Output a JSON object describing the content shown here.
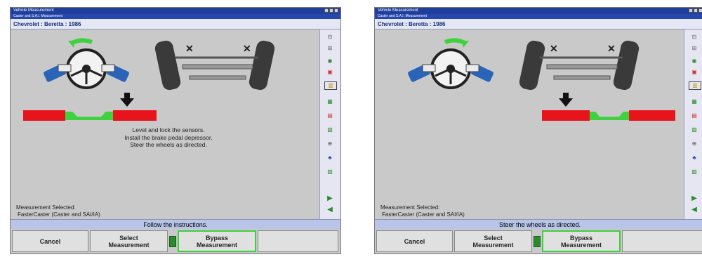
{
  "windows": [
    {
      "titlebar": "Vehicle Measurement",
      "subbar": "Caster and S.A.I. Measurement",
      "vehicle": "Chevrolet : Beretta : 1986",
      "instructions": [
        "Level and lock the sensors.",
        "Install the brake pedal depressor.",
        "Steer the wheels as directed."
      ],
      "measurement": {
        "heading": "Measurement Selected:",
        "value": "FasterCaster (Caster and SAI/IA)"
      },
      "status": "Follow the instructions.",
      "buttons": {
        "cancel": "Cancel",
        "select": "Select\nMeasurement",
        "bypass": "Bypass\nMeasurement"
      },
      "indicator_position": "right"
    },
    {
      "titlebar": "Vehicle Measurement",
      "subbar": "Caster and S.A.I. Measurement",
      "vehicle": "Chevrolet : Beretta : 1986",
      "instructions": [],
      "measurement": {
        "heading": "Measurement Selected:",
        "value": "FasterCaster (Caster and SAI/IA)"
      },
      "status": "Steer the wheels as directed.",
      "buttons": {
        "cancel": "Cancel",
        "select": "Select\nMeasurement",
        "bypass": "Bypass\nMeasurement"
      },
      "indicator_position": "left"
    }
  ],
  "sidebar_icons": [
    "camber-icon",
    "caster-icon",
    "toe-icon",
    "sai-icon",
    "setback-icon",
    "thrust-icon",
    "adjust-icon",
    "wheel-icon",
    "info-icon",
    "print-icon",
    "next-icon",
    "back-icon"
  ],
  "colors": {
    "accent": "#1f3f9a",
    "red_zone": "#e8141c",
    "green_zone": "#3ed33e",
    "highlight": "#3ecf3e"
  }
}
